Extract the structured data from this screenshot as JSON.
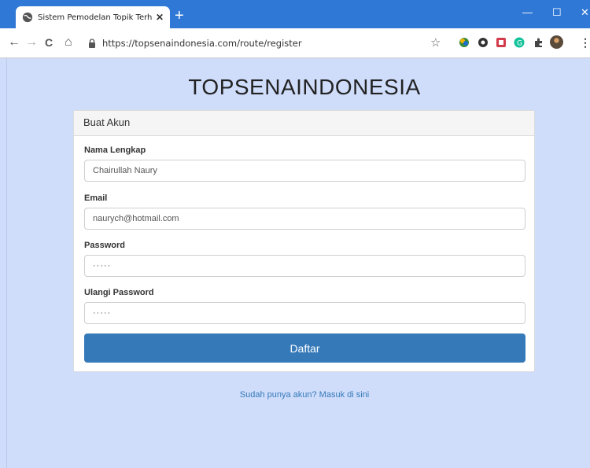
{
  "browser": {
    "tab_title": "Sistem Pemodelan Topik Terhada",
    "tab_close": "✕",
    "new_tab": "+",
    "url": "https://topsenaindonesia.com/route/register",
    "window_controls": {
      "minimize": "—",
      "maximize": "☐",
      "close": "✕"
    },
    "nav": {
      "back": "←",
      "forward": "→",
      "reload": "C",
      "home": "⌂"
    },
    "bookmark": "☆",
    "accent_color": "#2f78d6"
  },
  "page": {
    "title": "TOPSENAINDONESIA",
    "card_header": "Buat Akun",
    "fields": {
      "name": {
        "label": "Nama Lengkap",
        "value": "Chairullah Naury"
      },
      "email": {
        "label": "Email",
        "value": "naurych@hotmail.com"
      },
      "password": {
        "label": "Password",
        "value": "·····"
      },
      "repeat_password": {
        "label": "Ulangi Password",
        "value": "·····"
      }
    },
    "submit_label": "Daftar",
    "login_link": "Sudah punya akun? Masuk di sini",
    "button_color": "#3579b8",
    "background_color": "#cfddfb"
  }
}
